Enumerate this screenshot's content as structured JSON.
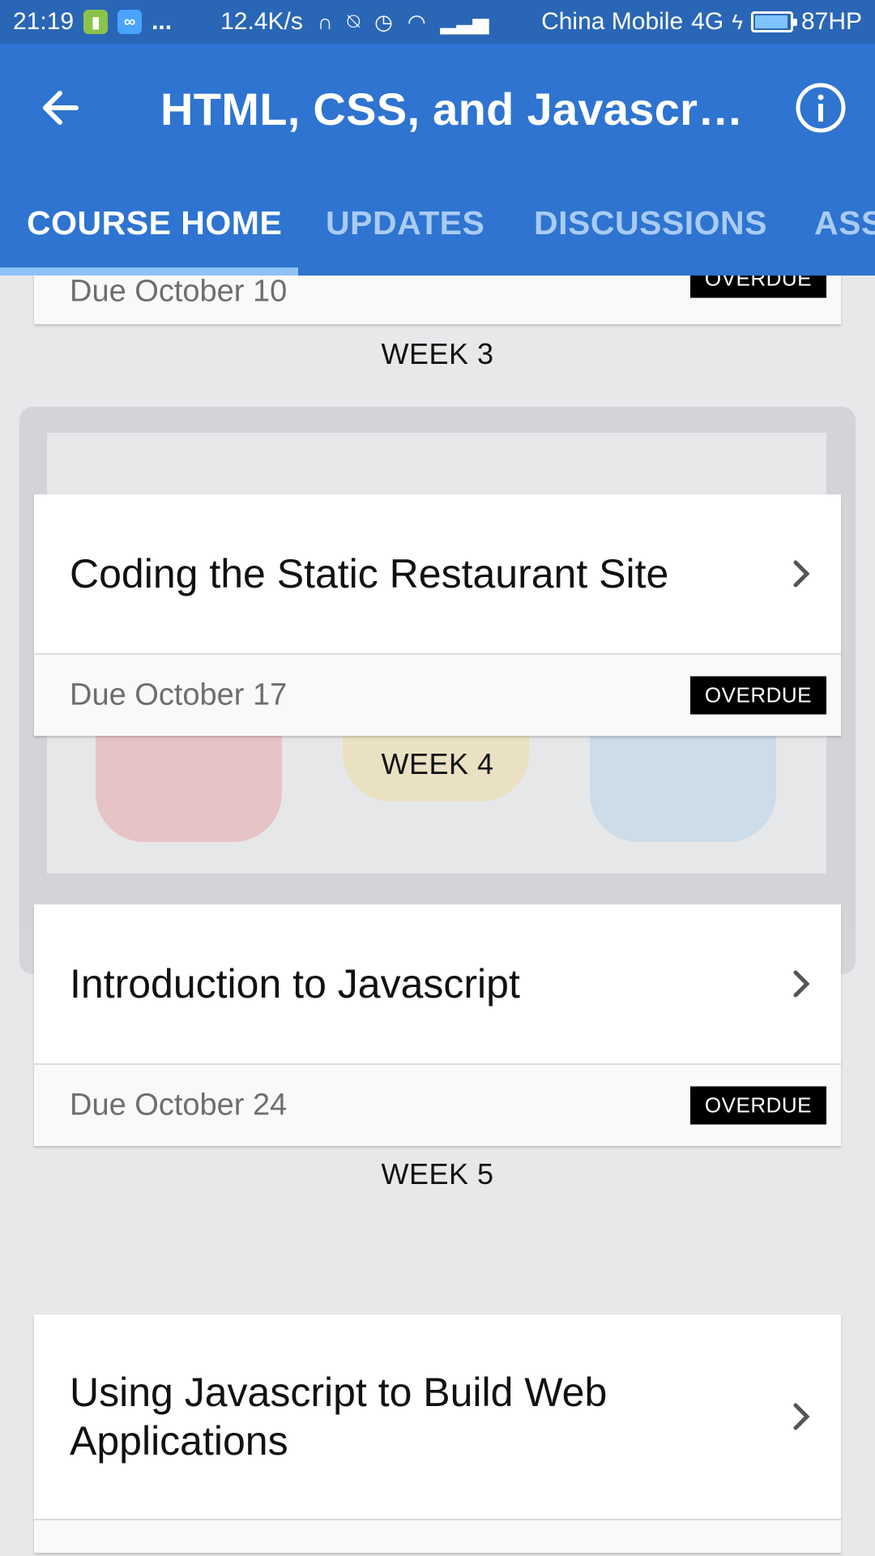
{
  "status_bar": {
    "time": "21:19",
    "more": "...",
    "speed": "12.4K/s",
    "carrier": "China Mobile",
    "network": "4G",
    "battery": "87HP",
    "battery_level": 0.87,
    "icons": [
      "sim-icon",
      "infinity-icon",
      "headset-icon",
      "mute-icon",
      "alarm-icon",
      "wifi-icon",
      "signal-icon",
      "charging-icon",
      "battery-icon"
    ]
  },
  "app_bar": {
    "title": "HTML, CSS, and Javascript…",
    "back_icon": "arrow-left-icon",
    "info_icon": "info-circle-icon",
    "color": "#2e74d0"
  },
  "tabs": [
    {
      "label": "COURSE HOME",
      "active": true
    },
    {
      "label": "UPDATES",
      "active": false
    },
    {
      "label": "DISCUSSIONS",
      "active": false
    },
    {
      "label": "ASS",
      "active": false
    }
  ],
  "partial_card": {
    "due": "Due October 10",
    "badge": "OVERDUE"
  },
  "weeks": [
    {
      "label": "WEEK 3",
      "title": "Coding the Static Restaurant Site",
      "due": "Due October 17",
      "badge": "OVERDUE"
    },
    {
      "label": "WEEK 4",
      "title": "Introduction to Javascript",
      "due": "Due October 24",
      "badge": "OVERDUE"
    },
    {
      "label": "WEEK 5",
      "title": "Using Javascript to Build Web Applications"
    }
  ]
}
